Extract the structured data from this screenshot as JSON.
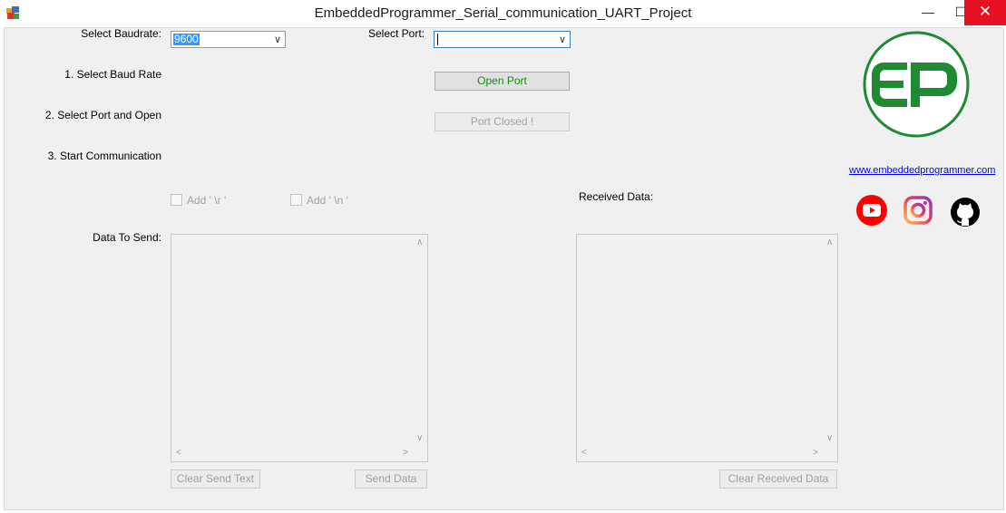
{
  "window": {
    "title": "EmbeddedProgrammer_Serial_communication_UART_Project",
    "minimize_glyph": "—",
    "maximize_glyph": "☐",
    "close_glyph": "✕"
  },
  "baudrate": {
    "label": "Select Baudrate:",
    "value": "9600"
  },
  "port": {
    "label": "Select Port:",
    "value": ""
  },
  "steps": {
    "step1": "1. Select Baud Rate",
    "step2": "2. Select Port and Open",
    "step3": "3. Start Communication"
  },
  "buttons": {
    "open_port": "Open Port",
    "port_status": "Port Closed !",
    "clear_send": "Clear Send Text",
    "send_data": "Send Data",
    "clear_received": "Clear Received Data"
  },
  "checkboxes": {
    "add_cr": "Add ' \\r '",
    "add_lf": "Add ' \\n '"
  },
  "send": {
    "label": "Data To Send:",
    "text": ""
  },
  "received": {
    "label": "Received Data:",
    "text": ""
  },
  "logo": {
    "text": "EP",
    "color": "#1e8a32"
  },
  "website": {
    "link_text": "www.embeddedprogrammer.com"
  },
  "social_icons": [
    "youtube-icon",
    "instagram-icon",
    "github-icon"
  ],
  "colors": {
    "accent_green": "#1e8a32",
    "link_blue": "#0000ee",
    "close_red": "#e81123",
    "youtube_red": "#ff0000"
  }
}
